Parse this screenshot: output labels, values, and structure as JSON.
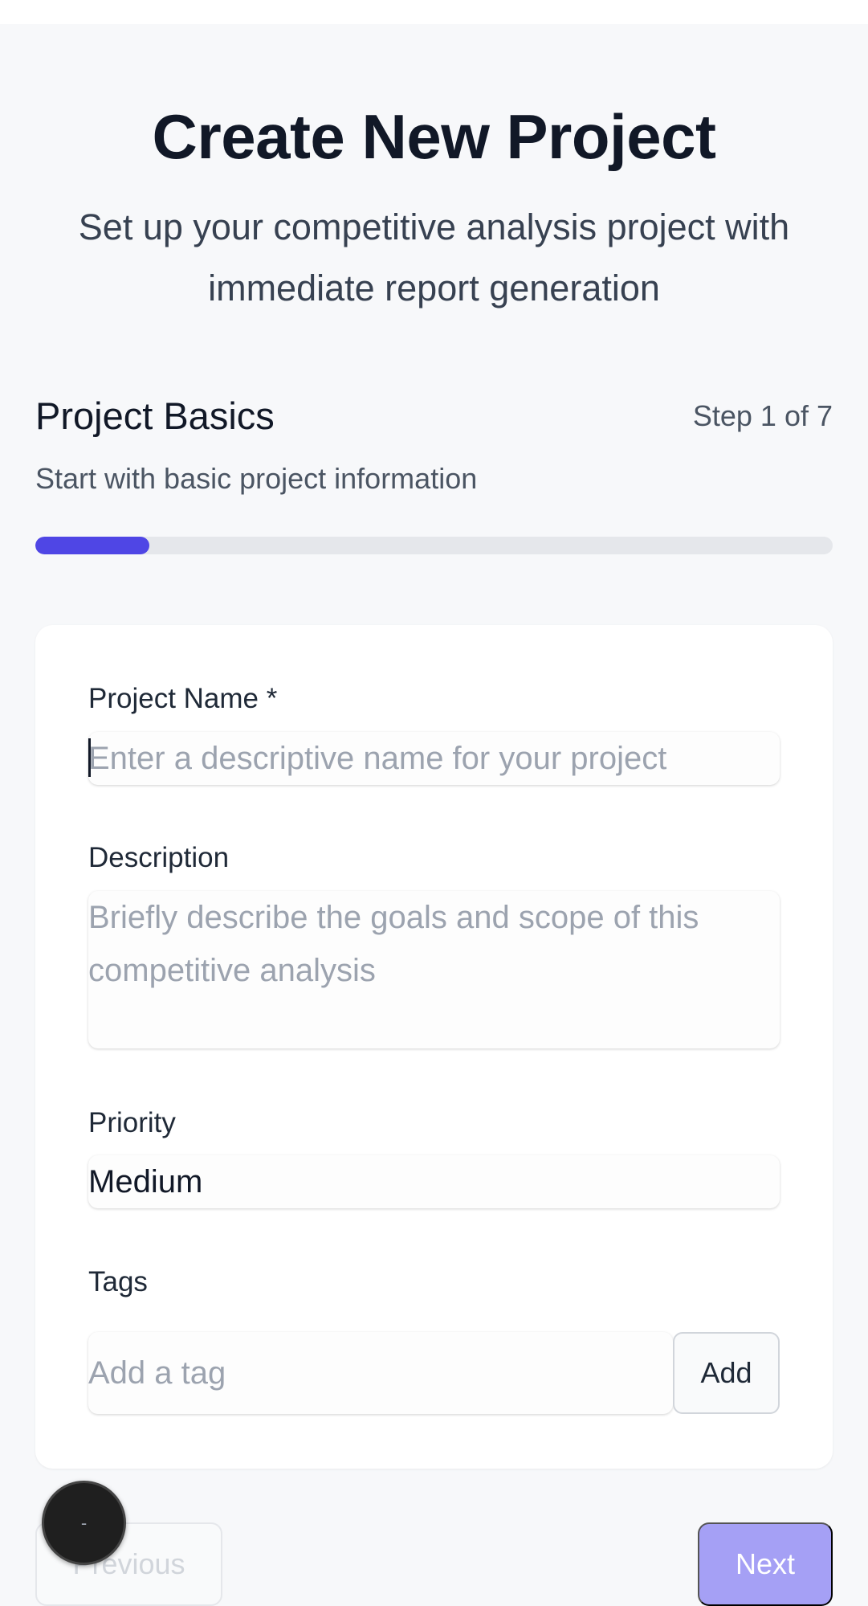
{
  "header": {
    "title": "Create New Project",
    "subtitle": "Set up your competitive analysis project with immediate report generation"
  },
  "step": {
    "title": "Project Basics",
    "counter": "Step 1 of 7",
    "description": "Start with basic project information",
    "progress_fraction": 0.143
  },
  "form": {
    "project_name": {
      "label": "Project Name *",
      "value": "",
      "placeholder": "Enter a descriptive name for your project"
    },
    "description": {
      "label": "Description",
      "value": "",
      "placeholder": "Briefly describe the goals and scope of this competitive analysis"
    },
    "priority": {
      "label": "Priority",
      "selected": "Medium"
    },
    "tags": {
      "label": "Tags",
      "placeholder": "Add a tag",
      "add_label": "Add"
    }
  },
  "nav": {
    "previous_label": "Previous",
    "next_label": "Next"
  },
  "fab": {
    "label": "-"
  },
  "colors": {
    "accent": "#4f46e5",
    "next_disabled": "#a5a0f5"
  }
}
